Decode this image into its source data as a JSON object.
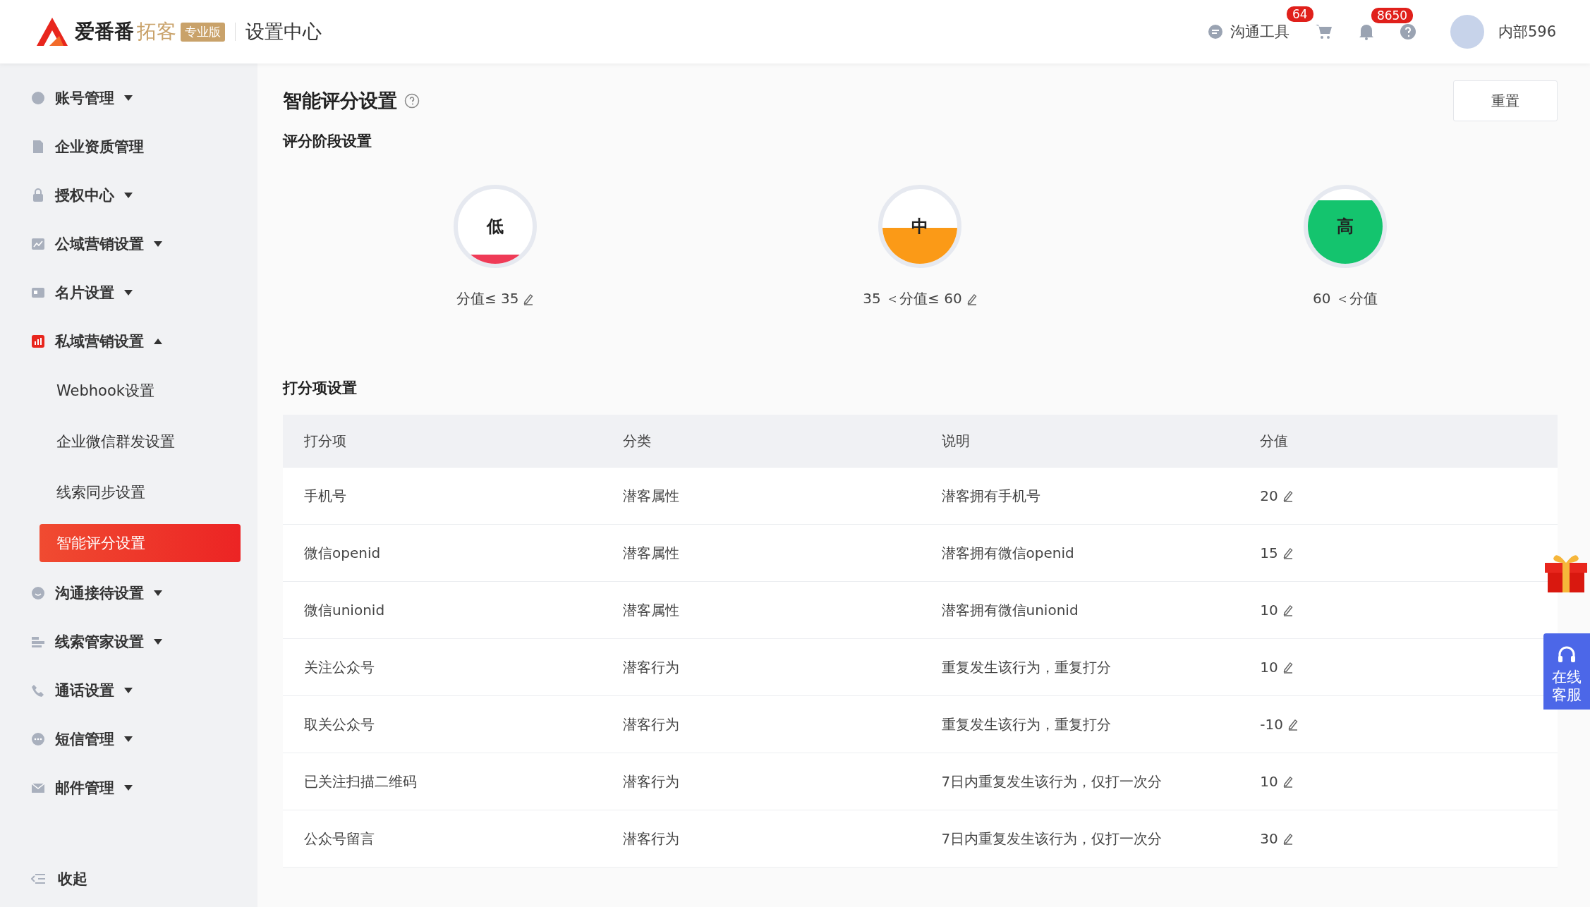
{
  "header": {
    "logo_name": "爱番番",
    "logo_product": "拓客",
    "edition_badge": "专业版",
    "title": "设置中心",
    "tools": [
      {
        "kind": "chat",
        "label": "沟通工具",
        "badge": "64"
      },
      {
        "kind": "cart"
      },
      {
        "kind": "bell",
        "badge": "8650"
      },
      {
        "kind": "help"
      }
    ],
    "user": {
      "name": "内部596"
    }
  },
  "sidebar": {
    "items": [
      {
        "kind": "account",
        "label": "账号管理",
        "expandable": true,
        "expanded": false,
        "selected": false
      },
      {
        "kind": "doc",
        "label": "企业资质管理",
        "expandable": false,
        "expanded": false,
        "selected": false
      },
      {
        "kind": "lock",
        "label": "授权中心",
        "expandable": true,
        "expanded": false,
        "selected": false
      },
      {
        "kind": "chart",
        "label": "公域营销设置",
        "expandable": true,
        "expanded": false,
        "selected": false
      },
      {
        "kind": "card",
        "label": "名片设置",
        "expandable": true,
        "expanded": false,
        "selected": false
      },
      {
        "kind": "bars",
        "label": "私域营销设置",
        "expandable": true,
        "expanded": true,
        "selected": true,
        "children": [
          {
            "label": "Webhook设置",
            "selected": false
          },
          {
            "label": "企业微信群发设置",
            "selected": false
          },
          {
            "label": "线索同步设置",
            "selected": false
          },
          {
            "label": "智能评分设置",
            "selected": true
          }
        ]
      },
      {
        "kind": "smile",
        "label": "沟通接待设置",
        "expandable": true,
        "expanded": false,
        "selected": false
      },
      {
        "kind": "list",
        "label": "线索管家设置",
        "expandable": true,
        "expanded": false,
        "selected": false
      },
      {
        "kind": "phone",
        "label": "通话设置",
        "expandable": true,
        "expanded": false,
        "selected": false
      },
      {
        "kind": "sms",
        "label": "短信管理",
        "expandable": true,
        "expanded": false,
        "selected": false
      },
      {
        "kind": "mail",
        "label": "邮件管理",
        "expandable": true,
        "expanded": false,
        "selected": false
      }
    ],
    "collapse_label": "收起"
  },
  "page": {
    "title": "智能评分设置",
    "reset_button": "重置",
    "stage_section": "评分阶段设置",
    "stages": [
      {
        "kind": "low",
        "label": "低",
        "range": "分值≤ 35",
        "editable": true,
        "color": "#ef3b57"
      },
      {
        "kind": "mid",
        "label": "中",
        "range": "35 ＜分值≤ 60",
        "editable": true,
        "color": "#fb9a17"
      },
      {
        "kind": "high",
        "label": "高",
        "range": "60 ＜分值",
        "editable": false,
        "color": "#14c46e"
      }
    ],
    "items_section": "打分项设置",
    "table": {
      "columns": [
        "打分项",
        "分类",
        "说明",
        "分值"
      ],
      "rows": [
        [
          "手机号",
          "潜客属性",
          "潜客拥有手机号",
          "20"
        ],
        [
          "微信openid",
          "潜客属性",
          "潜客拥有微信openid",
          "15"
        ],
        [
          "微信unionid",
          "潜客属性",
          "潜客拥有微信unionid",
          "10"
        ],
        [
          "关注公众号",
          "潜客行为",
          "重复发生该行为，重复打分",
          "10"
        ],
        [
          "取关公众号",
          "潜客行为",
          "重复发生该行为，重复打分",
          "-10"
        ],
        [
          "已关注扫描二维码",
          "潜客行为",
          "7日内重复发生该行为，仅打一次分",
          "10"
        ],
        [
          "公众号留言",
          "潜客行为",
          "7日内重复发生该行为，仅打一次分",
          "30"
        ]
      ]
    }
  },
  "float": {
    "service_label": "在线客服"
  }
}
